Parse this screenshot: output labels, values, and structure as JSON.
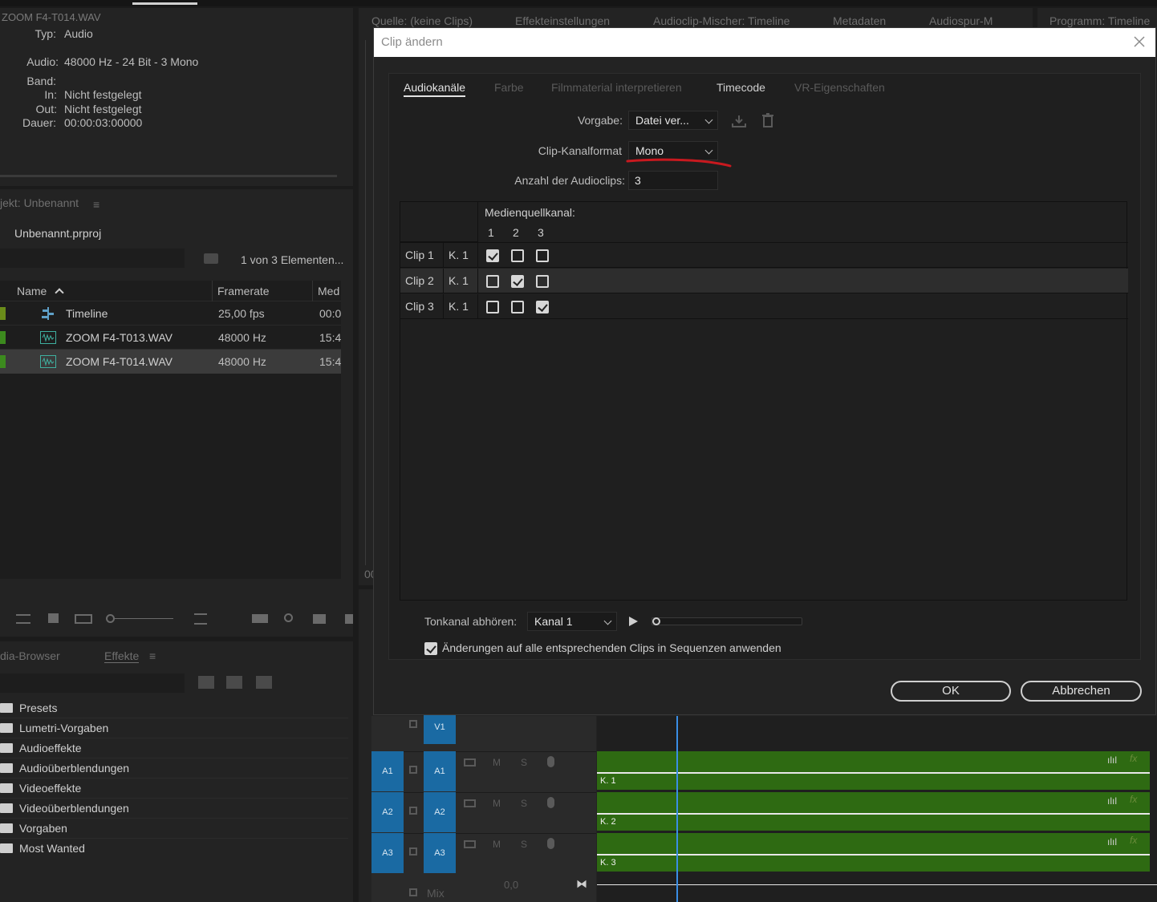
{
  "clip_info": {
    "filename": "ZOOM F4-T014.WAV",
    "type_label": "Typ:",
    "type_value": "Audio",
    "audio_label": "Audio:",
    "audio_value": "48000 Hz - 24 Bit - 3 Mono",
    "band_label": "Band:",
    "in_label": "In:",
    "in_value": "Nicht festgelegt",
    "out_label": "Out:",
    "out_value": "Nicht festgelegt",
    "duration_label": "Dauer:",
    "duration_value": "00:00:03:00000"
  },
  "project": {
    "panel_title": "jekt: Unbenannt",
    "project_file": "Unbenannt.prproj",
    "item_count": "1 von 3 Elementen...",
    "columns": {
      "name": "Name",
      "framerate": "Framerate",
      "media": "Med"
    },
    "items": [
      {
        "name": "Timeline",
        "framerate": "25,00 fps",
        "media": "00:0",
        "icon": "sequence-icon"
      },
      {
        "name": "ZOOM F4-T013.WAV",
        "framerate": "48000  Hz",
        "media": "15:4",
        "icon": "audio-file-icon"
      },
      {
        "name": "ZOOM F4-T014.WAV",
        "framerate": "48000  Hz",
        "media": "15:4",
        "icon": "audio-file-icon"
      }
    ]
  },
  "effects": {
    "tab_browser": "dia-Browser",
    "tab_effects": "Effekte",
    "items": [
      "Presets",
      "Lumetri-Vorgaben",
      "Audioeffekte",
      "Audioüberblendungen",
      "Videoeffekte",
      "Videoüberblendungen",
      "Vorgaben",
      "Most Wanted"
    ]
  },
  "source_tabs": [
    "Quelle: (keine Clips)",
    "Effekteinstellungen",
    "Audioclip-Mischer: Timeline",
    "Metadaten",
    "Audiospur-M"
  ],
  "program_tab": "Programm: Timeline",
  "timeline": {
    "v1": "V1",
    "tracks": [
      {
        "src": "A1",
        "dst": "A1",
        "m": "M",
        "s": "S",
        "clip_label": "K. 1"
      },
      {
        "src": "A2",
        "dst": "A2",
        "m": "M",
        "s": "S",
        "clip_label": "K. 2"
      },
      {
        "src": "A3",
        "dst": "A3",
        "m": "M",
        "s": "S",
        "clip_label": "K. 3"
      }
    ],
    "mix_label": "Mix",
    "mix_value": "0,0",
    "left_number": "00"
  },
  "dialog": {
    "title": "Clip ändern",
    "tabs": [
      "Audiokanäle",
      "Farbe",
      "Filmmaterial interpretieren",
      "Timecode",
      "VR-Eigenschaften"
    ],
    "preset_label": "Vorgabe:",
    "preset_value": "Datei ver...",
    "channel_format_label": "Clip-Kanalformat",
    "channel_format_value": "Mono",
    "clip_count_label": "Anzahl der Audioclips:",
    "clip_count_value": "3",
    "grid": {
      "header": "Medienquellkanal:",
      "channel_numbers": [
        "1",
        "2",
        "3"
      ],
      "rows": [
        {
          "clip": "Clip 1",
          "channel": "K. 1",
          "checks": [
            true,
            false,
            false
          ]
        },
        {
          "clip": "Clip 2",
          "channel": "K. 1",
          "checks": [
            false,
            true,
            false
          ]
        },
        {
          "clip": "Clip 3",
          "channel": "K. 1",
          "checks": [
            false,
            false,
            true
          ]
        }
      ]
    },
    "monitor_label": "Tonkanal abhören:",
    "monitor_value": "Kanal 1",
    "apply_checked": true,
    "apply_label": "Änderungen auf alle entsprechenden Clips in Sequenzen anwenden",
    "ok_label": "OK",
    "cancel_label": "Abbrechen"
  },
  "colors": {
    "accent_blue": "#1a6aa3",
    "clip_green": "#2e6a12",
    "annotation_red": "#c8191f",
    "playhead": "#3a8ee6"
  }
}
